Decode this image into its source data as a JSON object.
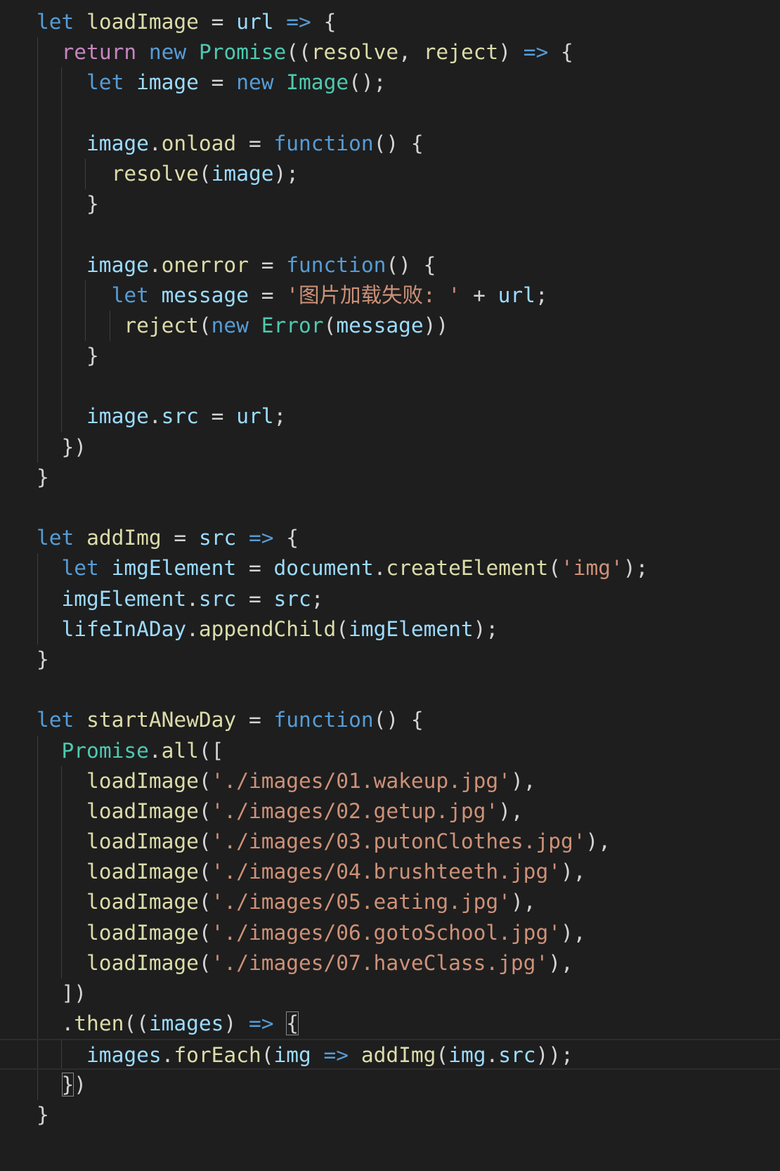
{
  "editor": {
    "lines": [
      {
        "guides": [],
        "tokens": [
          [
            "let",
            "kw"
          ],
          [
            " ",
            "pun"
          ],
          [
            "loadImage",
            "fn"
          ],
          [
            " = ",
            "pun"
          ],
          [
            "url",
            "var"
          ],
          [
            " ",
            "pun"
          ],
          [
            "=>",
            "kw"
          ],
          [
            " {",
            "pun"
          ]
        ]
      },
      {
        "guides": [
          1
        ],
        "tokens": [
          [
            "  ",
            "pun"
          ],
          [
            "return",
            "ctl"
          ],
          [
            " ",
            "pun"
          ],
          [
            "new",
            "kw"
          ],
          [
            " ",
            "pun"
          ],
          [
            "Promise",
            "type"
          ],
          [
            "((",
            "pun"
          ],
          [
            "resolve",
            "fn"
          ],
          [
            ", ",
            "pun"
          ],
          [
            "reject",
            "fn"
          ],
          [
            ") ",
            "pun"
          ],
          [
            "=>",
            "kw"
          ],
          [
            " {",
            "pun"
          ]
        ]
      },
      {
        "guides": [
          1,
          2
        ],
        "tokens": [
          [
            "    ",
            "pun"
          ],
          [
            "let",
            "kw"
          ],
          [
            " ",
            "pun"
          ],
          [
            "image",
            "var"
          ],
          [
            " = ",
            "pun"
          ],
          [
            "new",
            "kw"
          ],
          [
            " ",
            "pun"
          ],
          [
            "Image",
            "type"
          ],
          [
            "();",
            "pun"
          ]
        ]
      },
      {
        "guides": [
          1,
          2
        ],
        "tokens": []
      },
      {
        "guides": [
          1,
          2
        ],
        "tokens": [
          [
            "    ",
            "pun"
          ],
          [
            "image",
            "var"
          ],
          [
            ".",
            "pun"
          ],
          [
            "onload",
            "fn"
          ],
          [
            " = ",
            "pun"
          ],
          [
            "function",
            "kw"
          ],
          [
            "() {",
            "pun"
          ]
        ]
      },
      {
        "guides": [
          1,
          2,
          3
        ],
        "tokens": [
          [
            "      ",
            "pun"
          ],
          [
            "resolve",
            "fn"
          ],
          [
            "(",
            "pun"
          ],
          [
            "image",
            "var"
          ],
          [
            ");",
            "pun"
          ]
        ]
      },
      {
        "guides": [
          1,
          2
        ],
        "tokens": [
          [
            "    }",
            "pun"
          ]
        ]
      },
      {
        "guides": [
          1,
          2
        ],
        "tokens": []
      },
      {
        "guides": [
          1,
          2
        ],
        "tokens": [
          [
            "    ",
            "pun"
          ],
          [
            "image",
            "var"
          ],
          [
            ".",
            "pun"
          ],
          [
            "onerror",
            "fn"
          ],
          [
            " = ",
            "pun"
          ],
          [
            "function",
            "kw"
          ],
          [
            "() {",
            "pun"
          ]
        ]
      },
      {
        "guides": [
          1,
          2,
          3
        ],
        "tokens": [
          [
            "      ",
            "pun"
          ],
          [
            "let",
            "kw"
          ],
          [
            " ",
            "pun"
          ],
          [
            "message",
            "var"
          ],
          [
            " = ",
            "pun"
          ],
          [
            "'图片加载失败: '",
            "str"
          ],
          [
            " + ",
            "pun"
          ],
          [
            "url",
            "var"
          ],
          [
            ";",
            "pun"
          ]
        ]
      },
      {
        "guides": [
          1,
          2,
          3,
          4
        ],
        "tokens": [
          [
            "       ",
            "pun"
          ],
          [
            "reject",
            "fn"
          ],
          [
            "(",
            "pun"
          ],
          [
            "new",
            "kw"
          ],
          [
            " ",
            "pun"
          ],
          [
            "Error",
            "type"
          ],
          [
            "(",
            "pun"
          ],
          [
            "message",
            "var"
          ],
          [
            "))",
            "pun"
          ]
        ]
      },
      {
        "guides": [
          1,
          2
        ],
        "tokens": [
          [
            "    }",
            "pun"
          ]
        ]
      },
      {
        "guides": [
          1,
          2
        ],
        "tokens": []
      },
      {
        "guides": [
          1,
          2
        ],
        "tokens": [
          [
            "    ",
            "pun"
          ],
          [
            "image",
            "var"
          ],
          [
            ".",
            "pun"
          ],
          [
            "src",
            "var"
          ],
          [
            " = ",
            "pun"
          ],
          [
            "url",
            "var"
          ],
          [
            ";",
            "pun"
          ]
        ]
      },
      {
        "guides": [
          1
        ],
        "tokens": [
          [
            "  })",
            "pun"
          ]
        ]
      },
      {
        "guides": [],
        "tokens": [
          [
            "}",
            "pun"
          ]
        ]
      },
      {
        "guides": [],
        "tokens": []
      },
      {
        "guides": [],
        "tokens": [
          [
            "let",
            "kw"
          ],
          [
            " ",
            "pun"
          ],
          [
            "addImg",
            "fn"
          ],
          [
            " = ",
            "pun"
          ],
          [
            "src",
            "var"
          ],
          [
            " ",
            "pun"
          ],
          [
            "=>",
            "kw"
          ],
          [
            " {",
            "pun"
          ]
        ]
      },
      {
        "guides": [
          1
        ],
        "tokens": [
          [
            "  ",
            "pun"
          ],
          [
            "let",
            "kw"
          ],
          [
            " ",
            "pun"
          ],
          [
            "imgElement",
            "var"
          ],
          [
            " = ",
            "pun"
          ],
          [
            "document",
            "var"
          ],
          [
            ".",
            "pun"
          ],
          [
            "createElement",
            "fn"
          ],
          [
            "(",
            "pun"
          ],
          [
            "'img'",
            "str"
          ],
          [
            ");",
            "pun"
          ]
        ]
      },
      {
        "guides": [
          1
        ],
        "tokens": [
          [
            "  ",
            "pun"
          ],
          [
            "imgElement",
            "var"
          ],
          [
            ".",
            "pun"
          ],
          [
            "src",
            "var"
          ],
          [
            " = ",
            "pun"
          ],
          [
            "src",
            "var"
          ],
          [
            ";",
            "pun"
          ]
        ]
      },
      {
        "guides": [
          1
        ],
        "tokens": [
          [
            "  ",
            "pun"
          ],
          [
            "lifeInADay",
            "var"
          ],
          [
            ".",
            "pun"
          ],
          [
            "appendChild",
            "fn"
          ],
          [
            "(",
            "pun"
          ],
          [
            "imgElement",
            "var"
          ],
          [
            ");",
            "pun"
          ]
        ]
      },
      {
        "guides": [],
        "tokens": [
          [
            "}",
            "pun"
          ]
        ]
      },
      {
        "guides": [],
        "tokens": []
      },
      {
        "guides": [],
        "tokens": [
          [
            "let",
            "kw"
          ],
          [
            " ",
            "pun"
          ],
          [
            "startANewDay",
            "fn"
          ],
          [
            " = ",
            "pun"
          ],
          [
            "function",
            "kw"
          ],
          [
            "() {",
            "pun"
          ]
        ]
      },
      {
        "guides": [
          1
        ],
        "tokens": [
          [
            "  ",
            "pun"
          ],
          [
            "Promise",
            "type"
          ],
          [
            ".",
            "pun"
          ],
          [
            "all",
            "fn"
          ],
          [
            "([",
            "pun"
          ]
        ]
      },
      {
        "guides": [
          1,
          2
        ],
        "tokens": [
          [
            "    ",
            "pun"
          ],
          [
            "loadImage",
            "fn"
          ],
          [
            "(",
            "pun"
          ],
          [
            "'./images/01.wakeup.jpg'",
            "str"
          ],
          [
            "),",
            "pun"
          ]
        ]
      },
      {
        "guides": [
          1,
          2
        ],
        "tokens": [
          [
            "    ",
            "pun"
          ],
          [
            "loadImage",
            "fn"
          ],
          [
            "(",
            "pun"
          ],
          [
            "'./images/02.getup.jpg'",
            "str"
          ],
          [
            "),",
            "pun"
          ]
        ]
      },
      {
        "guides": [
          1,
          2
        ],
        "tokens": [
          [
            "    ",
            "pun"
          ],
          [
            "loadImage",
            "fn"
          ],
          [
            "(",
            "pun"
          ],
          [
            "'./images/03.putonClothes.jpg'",
            "str"
          ],
          [
            "),",
            "pun"
          ]
        ]
      },
      {
        "guides": [
          1,
          2
        ],
        "tokens": [
          [
            "    ",
            "pun"
          ],
          [
            "loadImage",
            "fn"
          ],
          [
            "(",
            "pun"
          ],
          [
            "'./images/04.brushteeth.jpg'",
            "str"
          ],
          [
            "),",
            "pun"
          ]
        ]
      },
      {
        "guides": [
          1,
          2
        ],
        "tokens": [
          [
            "    ",
            "pun"
          ],
          [
            "loadImage",
            "fn"
          ],
          [
            "(",
            "pun"
          ],
          [
            "'./images/05.eating.jpg'",
            "str"
          ],
          [
            "),",
            "pun"
          ]
        ]
      },
      {
        "guides": [
          1,
          2
        ],
        "tokens": [
          [
            "    ",
            "pun"
          ],
          [
            "loadImage",
            "fn"
          ],
          [
            "(",
            "pun"
          ],
          [
            "'./images/06.gotoSchool.jpg'",
            "str"
          ],
          [
            "),",
            "pun"
          ]
        ]
      },
      {
        "guides": [
          1,
          2
        ],
        "tokens": [
          [
            "    ",
            "pun"
          ],
          [
            "loadImage",
            "fn"
          ],
          [
            "(",
            "pun"
          ],
          [
            "'./images/07.haveClass.jpg'",
            "str"
          ],
          [
            "),",
            "pun"
          ]
        ]
      },
      {
        "guides": [
          1
        ],
        "tokens": [
          [
            "  ])",
            "pun"
          ]
        ]
      },
      {
        "guides": [
          1
        ],
        "tokens": [
          [
            "  .",
            "pun"
          ],
          [
            "then",
            "fn"
          ],
          [
            "((",
            "pun"
          ],
          [
            "images",
            "var"
          ],
          [
            ") ",
            "pun"
          ],
          [
            "=>",
            "kw"
          ],
          [
            " ",
            "pun"
          ],
          [
            "{",
            "bm"
          ]
        ]
      },
      {
        "guides": [
          1,
          2
        ],
        "active": true,
        "tokens": [
          [
            "    ",
            "pun"
          ],
          [
            "images",
            "var"
          ],
          [
            ".",
            "pun"
          ],
          [
            "forEach",
            "fn"
          ],
          [
            "(",
            "pun"
          ],
          [
            "img",
            "var"
          ],
          [
            " ",
            "pun"
          ],
          [
            "=>",
            "kw"
          ],
          [
            " ",
            "pun"
          ],
          [
            "addImg",
            "fn"
          ],
          [
            "(",
            "pun"
          ],
          [
            "img",
            "var"
          ],
          [
            ".",
            "pun"
          ],
          [
            "src",
            "var"
          ],
          [
            "));",
            "pun"
          ]
        ]
      },
      {
        "guides": [
          1
        ],
        "tokens": [
          [
            "  ",
            "pun"
          ],
          [
            "}",
            "bm"
          ],
          [
            ")",
            "pun"
          ]
        ]
      },
      {
        "guides": [],
        "tokens": [
          [
            "}",
            "pun"
          ]
        ]
      }
    ]
  }
}
